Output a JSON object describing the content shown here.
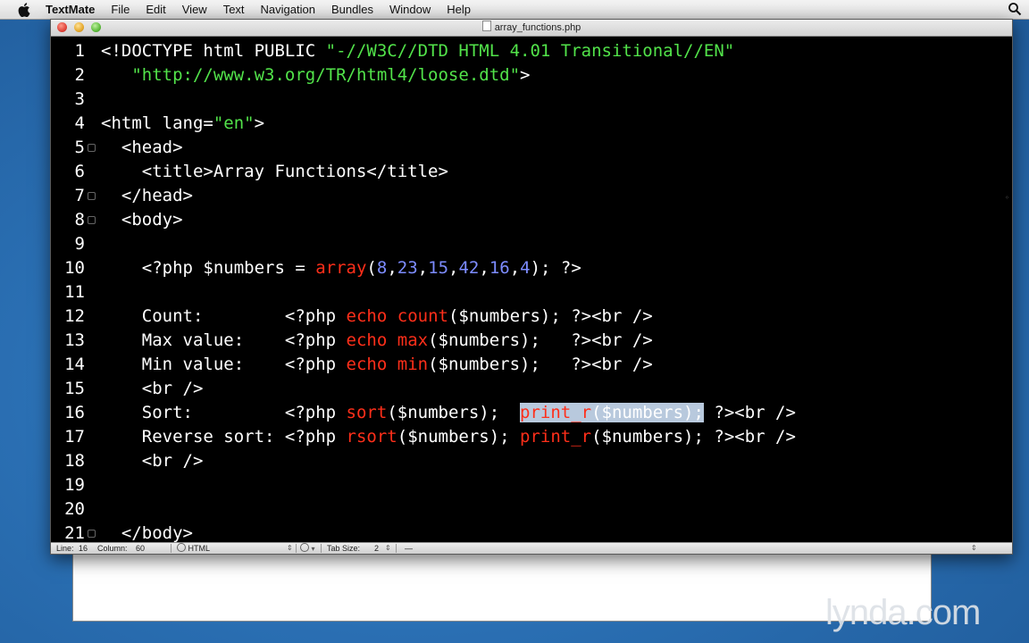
{
  "menubar": {
    "app": "TextMate",
    "items": [
      "File",
      "Edit",
      "View",
      "Text",
      "Navigation",
      "Bundles",
      "Window",
      "Help"
    ]
  },
  "window": {
    "title": "array_functions.php"
  },
  "editor": {
    "lines": [
      {
        "n": "1",
        "fold": false,
        "html": "<span class=\"\">&lt;!DOCTYPE html PUBLIC </span><span class=\"str\">\"-//W3C//DTD HTML 4.01 Transitional//EN\"</span>"
      },
      {
        "n": "2",
        "fold": false,
        "html": "   <span class=\"str\">\"http://www.w3.org/TR/html4/loose.dtd\"</span>&gt;"
      },
      {
        "n": "3",
        "fold": false,
        "html": ""
      },
      {
        "n": "4",
        "fold": false,
        "html": "&lt;html lang=<span class=\"str\">\"en\"</span>&gt;"
      },
      {
        "n": "5",
        "fold": true,
        "html": "  &lt;head&gt;"
      },
      {
        "n": "6",
        "fold": false,
        "html": "    &lt;title&gt;Array Functions&lt;/title&gt;"
      },
      {
        "n": "7",
        "fold": true,
        "html": "  &lt;/head&gt;"
      },
      {
        "n": "8",
        "fold": true,
        "html": "  &lt;body&gt;"
      },
      {
        "n": "9",
        "fold": false,
        "html": ""
      },
      {
        "n": "10",
        "fold": false,
        "html": "    &lt;?php $numbers = <span class=\"kw\">array</span>(<span class=\"num\">8</span>,<span class=\"num\">23</span>,<span class=\"num\">15</span>,<span class=\"num\">42</span>,<span class=\"num\">16</span>,<span class=\"num\">4</span>); ?&gt;"
      },
      {
        "n": "11",
        "fold": false,
        "html": ""
      },
      {
        "n": "12",
        "fold": false,
        "html": "    Count:        &lt;?php <span class=\"kw\">echo</span> <span class=\"kw\">count</span>($numbers); ?&gt;&lt;br /&gt;"
      },
      {
        "n": "13",
        "fold": false,
        "html": "    Max value:    &lt;?php <span class=\"kw\">echo</span> <span class=\"kw\">max</span>($numbers);   ?&gt;&lt;br /&gt;"
      },
      {
        "n": "14",
        "fold": false,
        "html": "    Min value:    &lt;?php <span class=\"kw\">echo</span> <span class=\"kw\">min</span>($numbers);   ?&gt;&lt;br /&gt;"
      },
      {
        "n": "15",
        "fold": false,
        "html": "    &lt;br /&gt;"
      },
      {
        "n": "16",
        "fold": false,
        "html": "    Sort:         &lt;?php <span class=\"kw\">sort</span>($numbers);  <span class=\"sel\"><span class=\"kw\">print_r</span>($numbers);</span> ?&gt;&lt;br /&gt;"
      },
      {
        "n": "17",
        "fold": false,
        "html": "    Reverse sort: &lt;?php <span class=\"kw\">rsort</span>($numbers); <span class=\"kw\">print_r</span>($numbers); ?&gt;&lt;br /&gt;"
      },
      {
        "n": "18",
        "fold": false,
        "html": "    &lt;br /&gt;"
      },
      {
        "n": "19",
        "fold": false,
        "html": ""
      },
      {
        "n": "20",
        "fold": false,
        "html": ""
      },
      {
        "n": "21",
        "fold": true,
        "html": "  &lt;/body&gt;"
      }
    ]
  },
  "statusbar": {
    "line_label": "Line:",
    "line_value": "16",
    "column_label": "Column:",
    "column_value": "60",
    "language": "HTML",
    "tab_label": "Tab Size:",
    "tab_value": "2",
    "dash": "—"
  },
  "watermark": "lynda.com"
}
